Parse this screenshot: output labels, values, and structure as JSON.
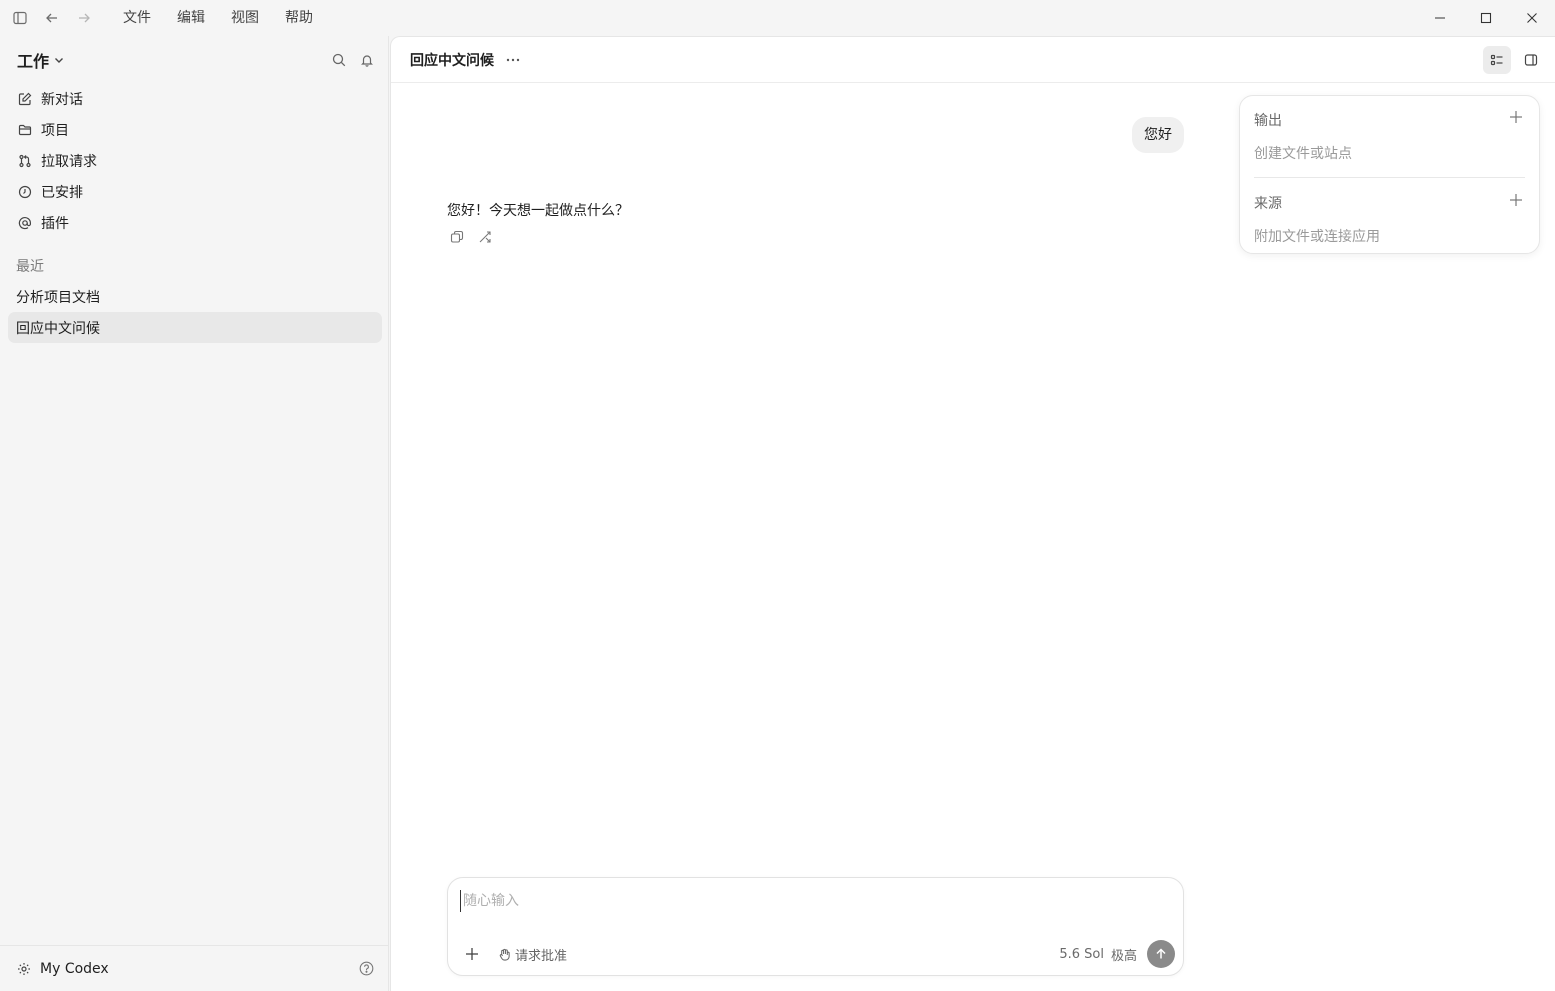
{
  "titlebar": {
    "menu": [
      "文件",
      "编辑",
      "视图",
      "帮助"
    ]
  },
  "sidebar": {
    "workspace": "工作",
    "nav": [
      {
        "label": "新对话",
        "icon": "edit-icon"
      },
      {
        "label": "项目",
        "icon": "folder-icon"
      },
      {
        "label": "拉取请求",
        "icon": "pull-request-icon"
      },
      {
        "label": "已安排",
        "icon": "clock-icon"
      },
      {
        "label": "插件",
        "icon": "at-icon"
      }
    ],
    "recent_label": "最近",
    "recent": [
      "分析项目文档",
      "回应中文问候"
    ],
    "footer_label": "My Codex"
  },
  "main": {
    "title": "回应中文问候",
    "user_message": "您好",
    "assistant_message": "您好！今天想一起做点什么？"
  },
  "panel": {
    "output_title": "输出",
    "output_sub": "创建文件或站点",
    "source_title": "来源",
    "source_sub": "附加文件或连接应用"
  },
  "composer": {
    "placeholder": "随心输入",
    "approve_label": "请求批准",
    "model": "5.6 Sol",
    "level": "极高"
  }
}
